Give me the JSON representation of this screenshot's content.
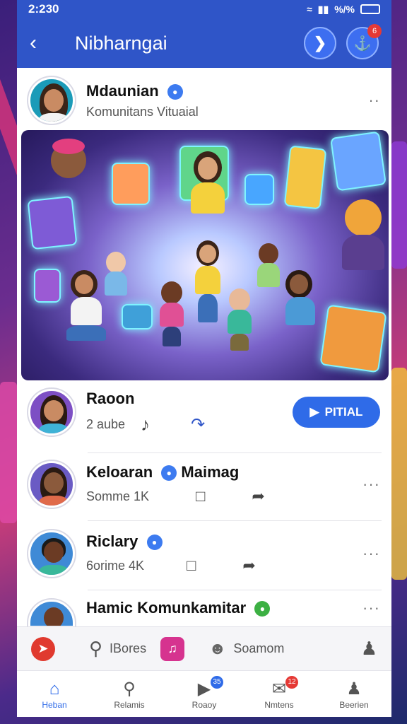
{
  "status_bar": {
    "time": "2:230",
    "battery": "%/%"
  },
  "header": {
    "title": "Nibharngai",
    "badge": "6"
  },
  "profile": {
    "name": "Mdaunian",
    "subtitle": "Komunitans Vituaial"
  },
  "rows": [
    {
      "name": "Raoon",
      "sub": "2 aube",
      "button": "PITIAL"
    },
    {
      "name": "Keloaran",
      "name2": "Maimag",
      "sub": "Somme 1K"
    },
    {
      "name": "Riclary",
      "sub": "6orime 4K"
    },
    {
      "name": "Hamic Komunkamitar"
    }
  ],
  "quick_bar": {
    "item1": "IBores",
    "item2": "Soamom"
  },
  "tabs": [
    {
      "label": "Heban",
      "icon": "home-icon"
    },
    {
      "label": "Relamis",
      "icon": "search-icon"
    },
    {
      "label": "Roaoy",
      "icon": "play-icon",
      "badge": "35"
    },
    {
      "label": "Nmtens",
      "icon": "chat-icon",
      "badge": "12"
    },
    {
      "label": "Beerien",
      "icon": "profile-icon"
    }
  ],
  "colors": {
    "primary": "#2f55c8",
    "accent": "#2f6be8",
    "badge": "#e53935"
  }
}
